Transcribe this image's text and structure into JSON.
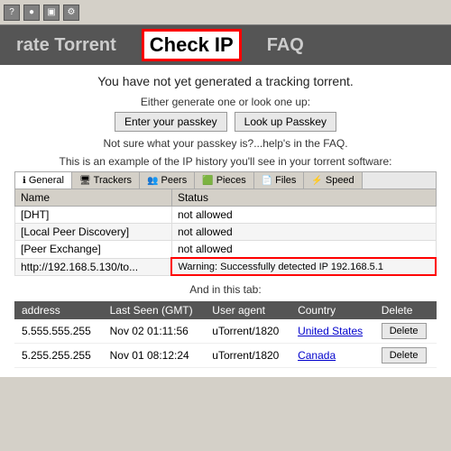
{
  "toolbar": {
    "icons": [
      "?",
      "●",
      "▣",
      "⚙"
    ]
  },
  "navbar": {
    "items": [
      {
        "label": "rate Torrent",
        "active": false
      },
      {
        "label": "Check IP",
        "active": true
      },
      {
        "label": "FAQ",
        "active": false
      }
    ]
  },
  "main": {
    "title": "You have not yet generated a tracking torrent.",
    "generate_label": "Either generate one or look one up:",
    "btn_enter": "Enter your passkey",
    "btn_lookup": "Look up Passkey",
    "help_text": "Not sure what your passkey is?...help's in the FAQ.",
    "example_label": "This is an example of the IP history you'll see in your torrent software:",
    "torrent_tabs": [
      {
        "label": "General",
        "icon": "ℹ"
      },
      {
        "label": "Trackers",
        "icon": "🖥"
      },
      {
        "label": "Peers",
        "icon": "👥"
      },
      {
        "label": "Pieces",
        "icon": "🟩"
      },
      {
        "label": "Files",
        "icon": "📄"
      },
      {
        "label": "Speed",
        "icon": "⚡"
      }
    ],
    "torrent_rows": [
      {
        "name": "[DHT]",
        "status": "not allowed"
      },
      {
        "name": "[Local Peer Discovery]",
        "status": "not allowed"
      },
      {
        "name": "[Peer Exchange]",
        "status": "not allowed"
      },
      {
        "name": "http://192.168.5.130/to...",
        "status": "Warning:",
        "success": "Successfully detected IP 192.168.5.1"
      }
    ],
    "and_in_this": "And in this tab:",
    "ip_table": {
      "headers": [
        "address",
        "Last Seen (GMT)",
        "User agent",
        "Country",
        "Delete"
      ],
      "rows": [
        {
          "address": "5.555.555.255",
          "last_seen": "Nov 02 01:11:56",
          "user_agent": "uTorrent/1820",
          "country": "United States",
          "delete_label": "Delete"
        },
        {
          "address": "5.255.255.255",
          "last_seen": "Nov 01 08:12:24",
          "user_agent": "uTorrent/1820",
          "country": "Canada",
          "delete_label": "Delete"
        }
      ]
    }
  }
}
